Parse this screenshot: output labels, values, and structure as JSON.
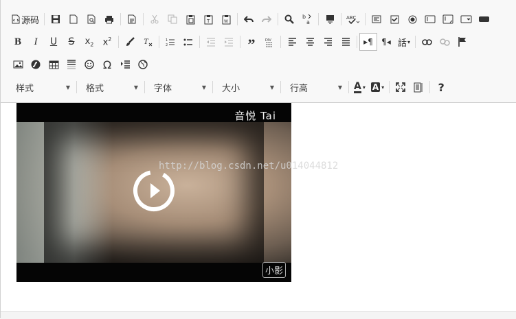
{
  "toolbar": {
    "source_label": "源码",
    "styles": "样式",
    "format": "格式",
    "font": "字体",
    "size": "大小",
    "line_height": "行高",
    "text_color_glyph": "A",
    "bg_color_glyph": "A"
  },
  "video": {
    "title": "音悦 Tai",
    "logo": "小影"
  },
  "watermark": "http://blog.csdn.net/u014044812"
}
